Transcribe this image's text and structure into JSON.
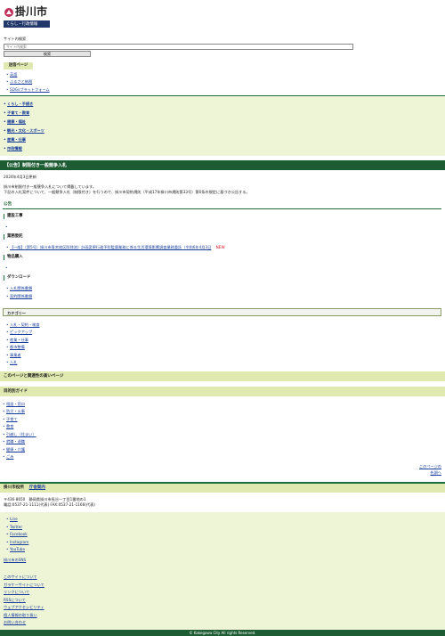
{
  "header": {
    "logo_text": "掛川市",
    "tagline": "くらし・行政情報"
  },
  "search": {
    "label": "サイト内検索",
    "placeholder": "サイト内検索",
    "button": "検索"
  },
  "home": {
    "label": "送信ページ",
    "links": [
      "英語",
      "ふるさと納税",
      "SDGsプラットフォーム"
    ]
  },
  "nav": {
    "items": [
      "くらし・手続き",
      "子育て・教育",
      "健康・福祉",
      "観光・文化・スポーツ",
      "産業・仕事",
      "市政情報"
    ]
  },
  "page": {
    "title": "【公告】制限付き一般競争入札",
    "updated": "2024年4月3日更新",
    "intro_1": "掛川市制限付き一般競争入札について掲載しています。",
    "intro_2": "下記の入札案件について、一般競争入札（制限付き）を行うので、掛川市契約規則（平成17年掛川市規則第33号）第6条の規定に基づき公告する。",
    "notice_heading": "公告",
    "sections": {
      "construction": "建設工事",
      "service": "業務委託",
      "service_link": "【一般】（第5号）掛川市青木地区防除池）計画変更行政予防監督業務に係る生活環境影響調査業務委託（令和6年4月3日",
      "new_badge": "NEW",
      "goods": "物品購入",
      "download": "ダウンロード",
      "download_links": [
        "入札関係書類",
        "契約関係書類"
      ]
    }
  },
  "category": {
    "heading": "カテゴリー",
    "links": [
      "入札・契約・検査",
      "ピックアップ",
      "産業・仕事",
      "都市整備",
      "事業者",
      "入札"
    ]
  },
  "related": {
    "heading": "このページと関連性の高いページ"
  },
  "guide": {
    "heading": "目的別ガイド",
    "links": [
      "相談・窓口",
      "防災・火事",
      "子育て",
      "教育",
      "引越し（住まい）",
      "就職・退職",
      "健康・介護",
      "ごみ"
    ]
  },
  "page_top": {
    "line1": "このページの",
    "line2": "先頭へ"
  },
  "footer": {
    "office_name": "掛川市役所",
    "office_link": "庁舎案内",
    "address": "〒436-8650　静岡県掛川市長谷一丁目1番地の1",
    "phone": "電話:0537-21-1111(代表) FAX:0537-21-1166(代表)",
    "sns": [
      "Line",
      "Twitter",
      "Facebook",
      "Instagram",
      "YouTube"
    ],
    "sns_label": "掛川市のSNS",
    "links": [
      "このサイトについて",
      "ガラケーサイトについて",
      "リンクについて",
      "RSSについて",
      "ウェブアクセシビリティ",
      "個人情報の取り扱い",
      "お問い合わせ"
    ],
    "copyright": "© Kakegawa City All rights Reserved."
  }
}
